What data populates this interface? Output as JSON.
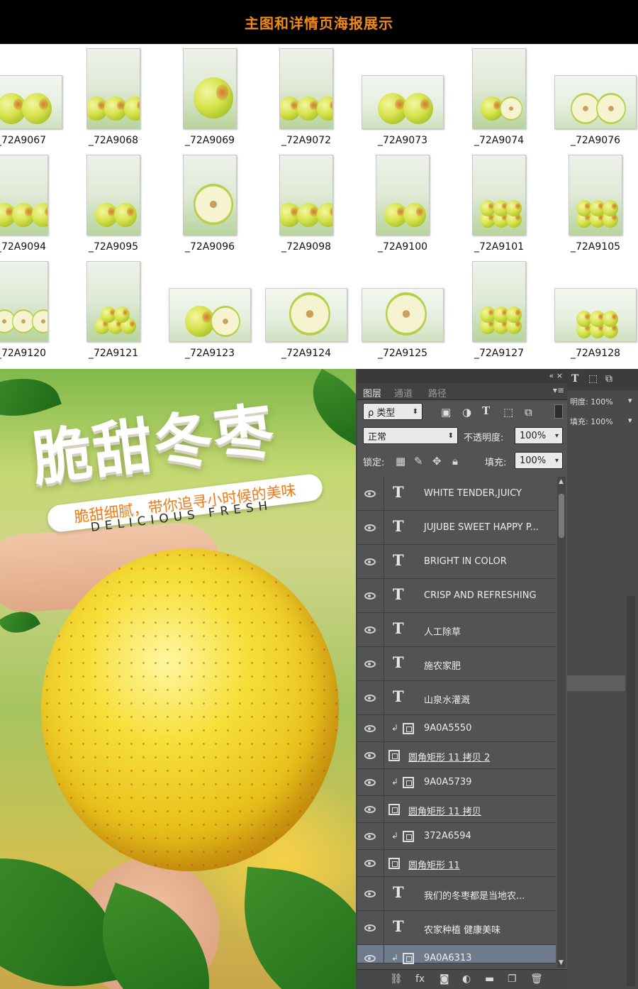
{
  "header": {
    "title": "主图和详情页海报展示"
  },
  "thumbnails": [
    {
      "name": "_72A9067",
      "shape": "land"
    },
    {
      "name": "_72A9068",
      "shape": "portrait"
    },
    {
      "name": "_72A9069",
      "shape": "portrait"
    },
    {
      "name": "_72A9072",
      "shape": "portrait"
    },
    {
      "name": "_72A9073",
      "shape": "land"
    },
    {
      "name": "_72A9074",
      "shape": "portrait"
    },
    {
      "name": "_72A9076",
      "shape": "land"
    },
    {
      "name": "_72A9094",
      "shape": "portrait"
    },
    {
      "name": "_72A9095",
      "shape": "portrait"
    },
    {
      "name": "_72A9096",
      "shape": "portrait"
    },
    {
      "name": "_72A9098",
      "shape": "portrait"
    },
    {
      "name": "_72A9100",
      "shape": "portrait"
    },
    {
      "name": "_72A9101",
      "shape": "portrait"
    },
    {
      "name": "_72A9105",
      "shape": "portrait"
    },
    {
      "name": "_72A9120",
      "shape": "portrait"
    },
    {
      "name": "_72A9121",
      "shape": "portrait"
    },
    {
      "name": "_72A9123",
      "shape": "land"
    },
    {
      "name": "_72A9124",
      "shape": "land"
    },
    {
      "name": "_72A9125",
      "shape": "land"
    },
    {
      "name": "_72A9127",
      "shape": "portrait"
    },
    {
      "name": "_72A9128",
      "shape": "land"
    }
  ],
  "poster": {
    "title": "脆甜冬枣",
    "slogan": "脆甜细腻，带你追寻小时候的美味",
    "subtitle": "DELICIOUS FRESH"
  },
  "layers_panel": {
    "panel_controls": "«  ×",
    "tabs": [
      "图层",
      "通道",
      "路径"
    ],
    "filter_label": "ρ 类型",
    "blend_mode": "正常",
    "opacity_label": "不透明度:",
    "opacity_value": "100%",
    "lock_label": "锁定:",
    "fill_label": "填充:",
    "fill_value": "100%",
    "layers": [
      {
        "type": "text",
        "name": "WHITE TENDER,JUICY"
      },
      {
        "type": "text",
        "name": "JUJUBE SWEET HAPPY P..."
      },
      {
        "type": "text",
        "name": "BRIGHT IN COLOR"
      },
      {
        "type": "text",
        "name": "CRISP AND REFRESHING"
      },
      {
        "type": "text",
        "name": "人工除草"
      },
      {
        "type": "text",
        "name": "施农家肥"
      },
      {
        "type": "text",
        "name": "山泉水灌溉"
      },
      {
        "type": "smart-clip",
        "name": "9A0A5550"
      },
      {
        "type": "shape",
        "name": "圆角矩形 11 拷贝 2"
      },
      {
        "type": "smart-clip",
        "name": "9A0A5739"
      },
      {
        "type": "shape",
        "name": "圆角矩形 11 拷贝"
      },
      {
        "type": "smart-clip",
        "name": "372A6594"
      },
      {
        "type": "shape",
        "name": "圆角矩形 11"
      },
      {
        "type": "text",
        "name": "我们的冬枣都是当地农..."
      },
      {
        "type": "text",
        "name": "农家种植 健康美味"
      },
      {
        "type": "smart-selected",
        "name": "9A0A6313"
      }
    ],
    "footer_icons": [
      "link-icon",
      "fx-icon",
      "mask-icon",
      "adjustment-icon",
      "folder-icon",
      "new-layer-icon",
      "trash-icon"
    ]
  },
  "right_dock": {
    "opacity_label": "明度:",
    "opacity_value": "100%",
    "fill_label": "填充:",
    "fill_value": "100%"
  }
}
